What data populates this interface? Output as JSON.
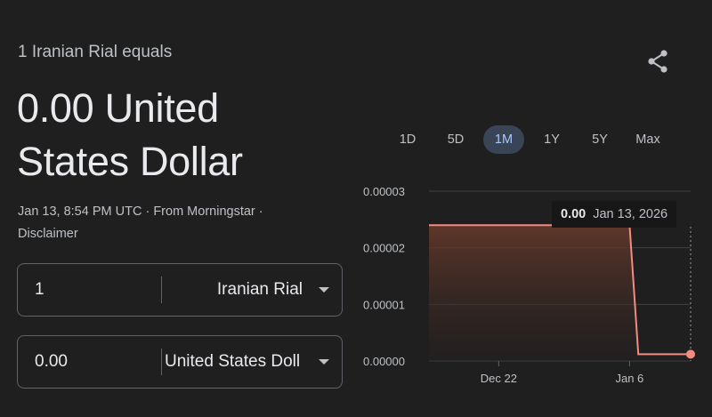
{
  "header": {
    "subtitle": "1 Iranian Rial equals",
    "headline_line1": "0.00 United",
    "headline_line2": "States Dollar",
    "timestamp": "Jan 13, 8:54 PM UTC",
    "source": "From Morningstar",
    "separator": "·",
    "disclaimer": "Disclaimer",
    "share_icon": "share-icon"
  },
  "converter": {
    "from": {
      "amount": "1",
      "currency": "Iranian Rial"
    },
    "to": {
      "amount": "0.00",
      "currency": "United States Doll"
    }
  },
  "ranges": {
    "items": [
      "1D",
      "5D",
      "1M",
      "1Y",
      "5Y",
      "Max"
    ],
    "active": "1M"
  },
  "tooltip": {
    "value": "0.00",
    "date": "Jan 13, 2026"
  },
  "colors": {
    "line": "#f28b82",
    "active_range_bg": "#394457",
    "active_range_text": "#a8c7fa",
    "background": "#1f1f1f"
  },
  "chart_data": {
    "type": "area",
    "y_ticks": [
      "0.00003",
      "0.00002",
      "0.00001",
      "0.00000"
    ],
    "x_ticks": [
      "Dec 22",
      "Jan 6"
    ],
    "ylim": [
      0,
      3e-05
    ],
    "xlim": [
      "Dec 14",
      "Jan 13"
    ],
    "series": [
      {
        "x": [
          "Dec 14",
          "Jan 6",
          "Jan 7",
          "Jan 13"
        ],
        "values": [
          2.4e-05,
          2.4e-05,
          1.2e-06,
          1.2e-06
        ]
      }
    ]
  }
}
